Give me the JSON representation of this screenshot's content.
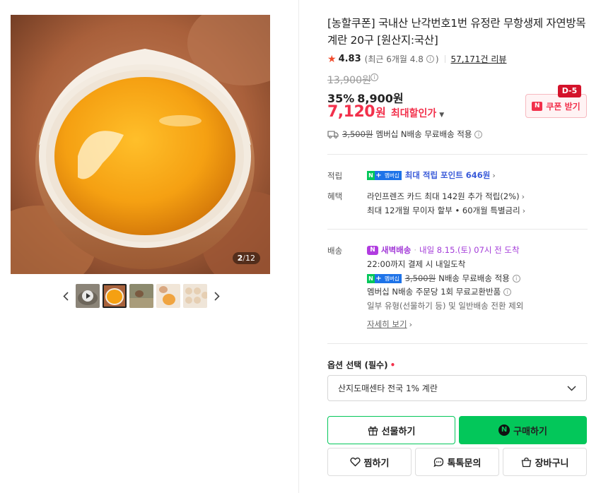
{
  "gallery": {
    "counter_current": "2",
    "counter_sep": "/",
    "counter_total": "12"
  },
  "product": {
    "title": "[농할쿠폰] 국내산 난각번호1번 유정란 무항생제 자연방목 계란 20구 [원산지:국산]",
    "rating": "4.83",
    "recent_rating": "(최근 6개월 4.8",
    "recent_close": ")",
    "review_count": "57,171건 리뷰",
    "original_price": "13,900원",
    "discount_rate": "35%",
    "discount_price": "8,900원",
    "max_price": "7,120",
    "max_unit": "원",
    "max_label": "최대할인가",
    "coupon_label": "쿠폰 받기",
    "coupon_badge": "D-5",
    "shipping_fee_strike": "3,500원",
    "shipping_text": "멤버십 N배송 무료배송 적용"
  },
  "benefits": {
    "points_label": "적립",
    "points_text": "최대 적립 포인트 646원",
    "perks_label": "혜택",
    "perk_1": "라인프렌즈 카드 최대 142원 추가 적립(2%)",
    "perk_2": "최대 12개월 무이자 할부 • 60개월 특별금리"
  },
  "delivery": {
    "label": "배송",
    "dawn_label": "새벽배송",
    "dawn_eta": "내일 8.15.(토) 07시 전 도착",
    "cutoff": "22:00까지 결제 시 내일도착",
    "nship_strike": "3,500원",
    "nship_text": "N배송 무료배송 적용",
    "return_text": "멤버십 N배송 주문당 1회 무료교환반품",
    "exception_text": "일부 유형(선물하기 등) 및 일반배송 전환 제외",
    "detail_link": "자세히 보기"
  },
  "nplus_badge": {
    "n": "N",
    "plus": "+",
    "member": "멤버십"
  },
  "options": {
    "label": "옵션 선택 (필수)",
    "required_mark": "•",
    "selected": "산지도매센타 전국 1% 계란"
  },
  "actions": {
    "gift": "선물하기",
    "buy": "구매하기",
    "wish": "찜하기",
    "talk": "톡톡문의",
    "cart": "장바구니"
  },
  "colors": {
    "accent_red": "#f2304b",
    "naver_green": "#03c75a",
    "membership_blue": "#1e73e8",
    "dawn_purple": "#a33bd8"
  }
}
